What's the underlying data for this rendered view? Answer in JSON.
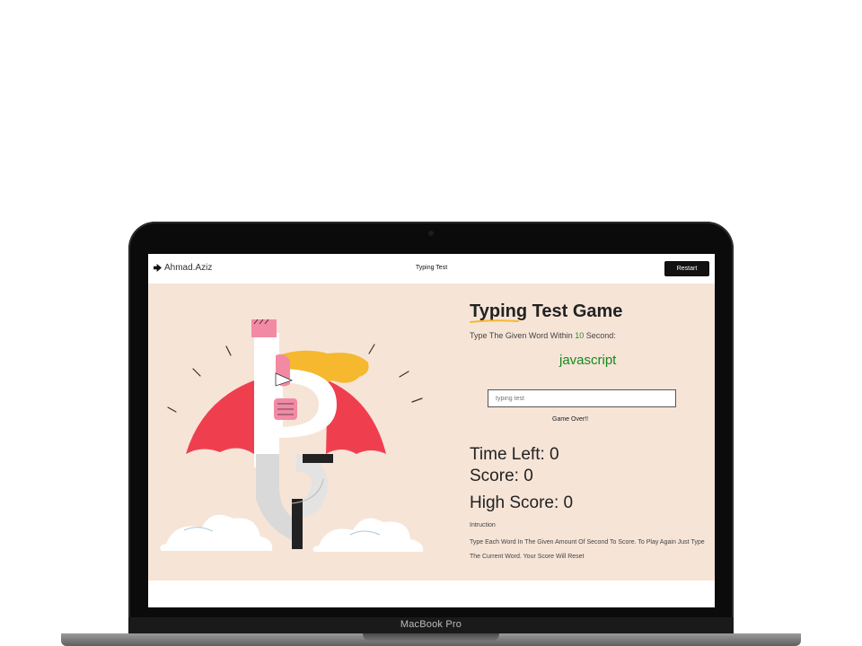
{
  "device": {
    "label": "MacBook Pro"
  },
  "nav": {
    "brand": "Ahmad.Aziz",
    "title": "Typing Test",
    "restart_label": "Restart"
  },
  "game": {
    "title": "Typing Test Game",
    "instruction_prefix": "Type The Given Word Within ",
    "seconds": "10",
    "instruction_suffix": " Second:",
    "current_word": "javascript",
    "input_placeholder": "typing test",
    "message": "Game Over!!",
    "time_left_label": "Time Left: ",
    "time_left": "0",
    "score_label": "Score: ",
    "score": "0",
    "high_score_label": "High Score: ",
    "high_score": "0",
    "instructions_title": "Intruction",
    "instructions_text": "Type Each Word In The Given Amount Of Second To Score. To Play Again Just Type The Current Word. Your Score Will Reset"
  },
  "colors": {
    "background": "#f6e4d7",
    "accent_green": "#138a1a",
    "cape_red": "#ef3f4f",
    "hair_yellow": "#f5b82e",
    "pink": "#f38aa4"
  }
}
